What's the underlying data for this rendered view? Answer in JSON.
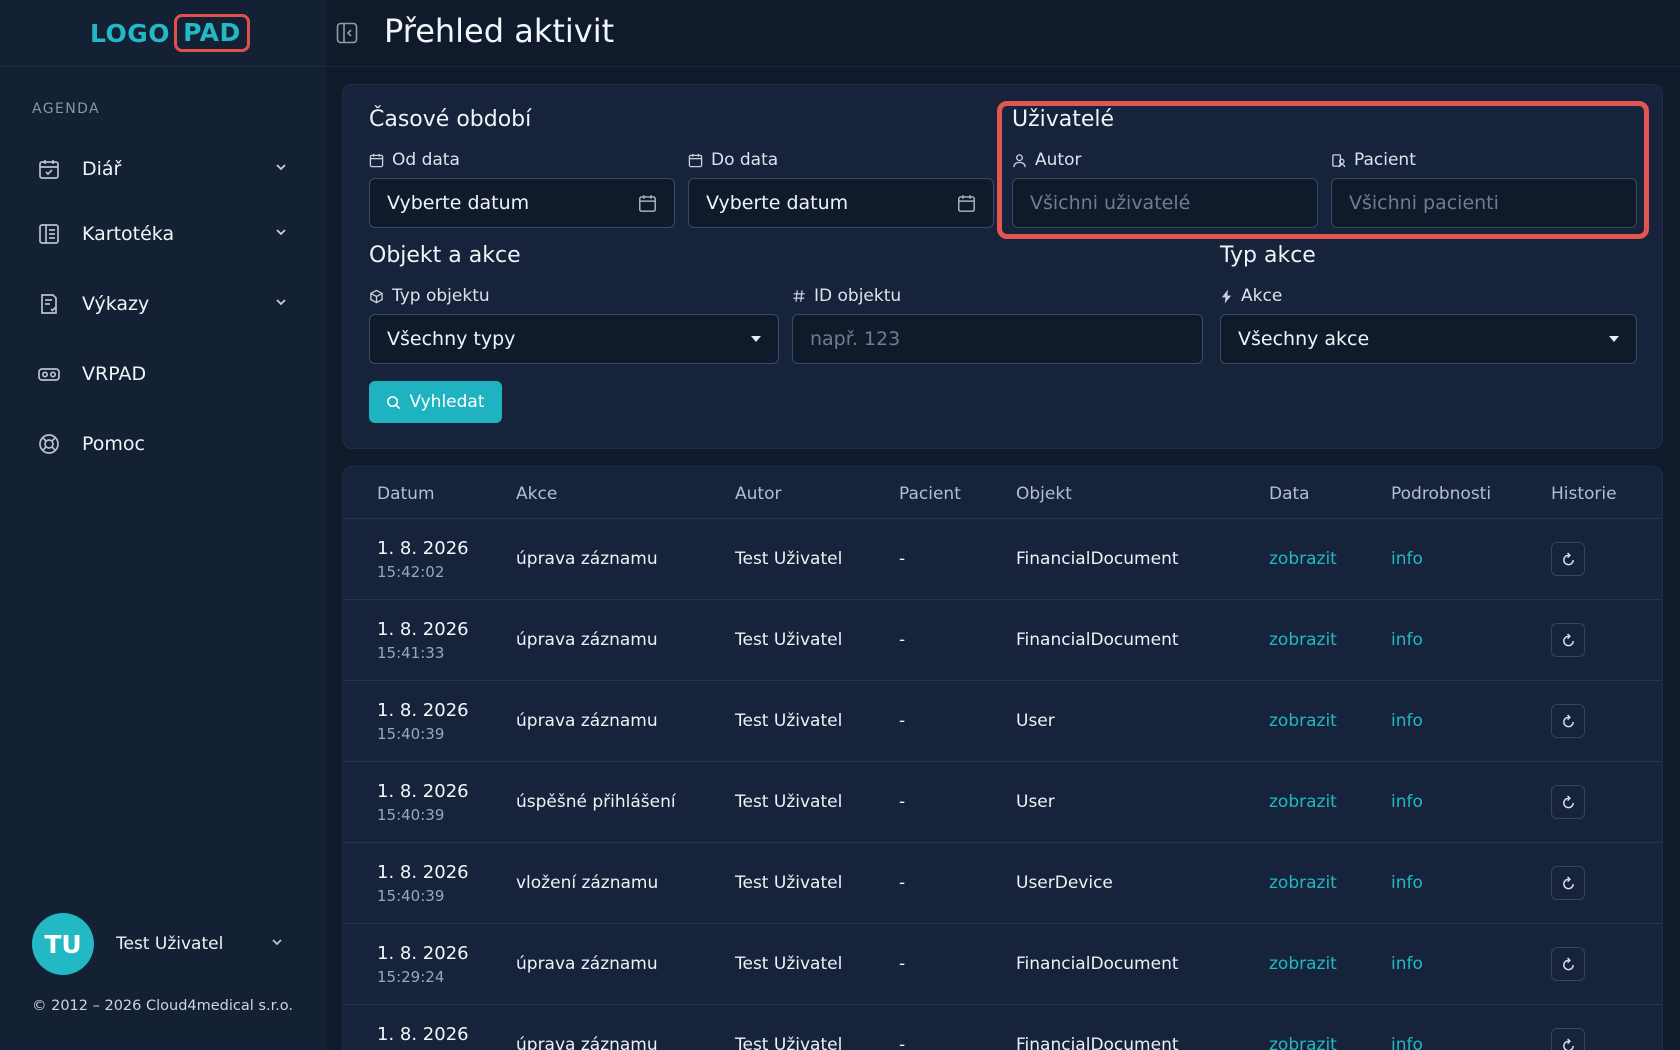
{
  "logo": {
    "part1": "LOGO",
    "part2": "PAD"
  },
  "sidebar": {
    "section_label": "AGENDA",
    "items": [
      {
        "label": "Diář",
        "icon": "calendar-check-icon",
        "has_chevron": true
      },
      {
        "label": "Kartotéka",
        "icon": "book-icon",
        "has_chevron": true
      },
      {
        "label": "Výkazy",
        "icon": "report-icon",
        "has_chevron": true
      },
      {
        "label": "VRPAD",
        "icon": "vr-headset-icon",
        "has_chevron": false
      },
      {
        "label": "Pomoc",
        "icon": "lifebuoy-icon",
        "has_chevron": false
      }
    ],
    "user": {
      "initials": "TU",
      "name": "Test Uživatel"
    },
    "copyright": "© 2012 – 2026 Cloud4medical s.r.o."
  },
  "header": {
    "title": "Přehled aktivit"
  },
  "filters": {
    "time_period": {
      "title": "Časové období",
      "from_label": "Od data",
      "from_value": "Vyberte datum",
      "to_label": "Do data",
      "to_value": "Vyberte datum"
    },
    "users": {
      "title": "Uživatelé",
      "author_label": "Autor",
      "author_placeholder": "Všichni uživatelé",
      "patient_label": "Pacient",
      "patient_placeholder": "Všichni pacienti"
    },
    "object": {
      "title": "Objekt a akce",
      "type_label": "Typ objektu",
      "type_value": "Všechny typy",
      "id_label": "ID objektu",
      "id_placeholder": "např. 123"
    },
    "action": {
      "title": "Typ akce",
      "action_label": "Akce",
      "action_value": "Všechny akce"
    },
    "search_button": "Vyhledat"
  },
  "table": {
    "columns": [
      "Datum",
      "Akce",
      "Autor",
      "Pacient",
      "Objekt",
      "Data",
      "Podrobnosti",
      "Historie"
    ],
    "rows": [
      {
        "date": "1. 8. 2026",
        "time": "15:42:02",
        "action": "úprava záznamu",
        "author": "Test Uživatel",
        "patient": "-",
        "object": "FinancialDocument",
        "data_link": "zobrazit",
        "details_link": "info"
      },
      {
        "date": "1. 8. 2026",
        "time": "15:41:33",
        "action": "úprava záznamu",
        "author": "Test Uživatel",
        "patient": "-",
        "object": "FinancialDocument",
        "data_link": "zobrazit",
        "details_link": "info"
      },
      {
        "date": "1. 8. 2026",
        "time": "15:40:39",
        "action": "úprava záznamu",
        "author": "Test Uživatel",
        "patient": "-",
        "object": "User",
        "data_link": "zobrazit",
        "details_link": "info"
      },
      {
        "date": "1. 8. 2026",
        "time": "15:40:39",
        "action": "úspěšné přihlášení",
        "author": "Test Uživatel",
        "patient": "-",
        "object": "User",
        "data_link": "zobrazit",
        "details_link": "info"
      },
      {
        "date": "1. 8. 2026",
        "time": "15:40:39",
        "action": "vložení záznamu",
        "author": "Test Uživatel",
        "patient": "-",
        "object": "UserDevice",
        "data_link": "zobrazit",
        "details_link": "info"
      },
      {
        "date": "1. 8. 2026",
        "time": "15:29:24",
        "action": "úprava záznamu",
        "author": "Test Uživatel",
        "patient": "-",
        "object": "FinancialDocument",
        "data_link": "zobrazit",
        "details_link": "info"
      },
      {
        "date": "1. 8. 2026",
        "time": "",
        "action": "úprava záznamu",
        "author": "Test Uživatel",
        "patient": "-",
        "object": "FinancialDocument",
        "data_link": "zobrazit",
        "details_link": "info"
      }
    ]
  },
  "colors": {
    "accent": "#22b8c4",
    "highlight": "#e25651",
    "background": "#0f1a2b",
    "sidebar": "#142033"
  }
}
